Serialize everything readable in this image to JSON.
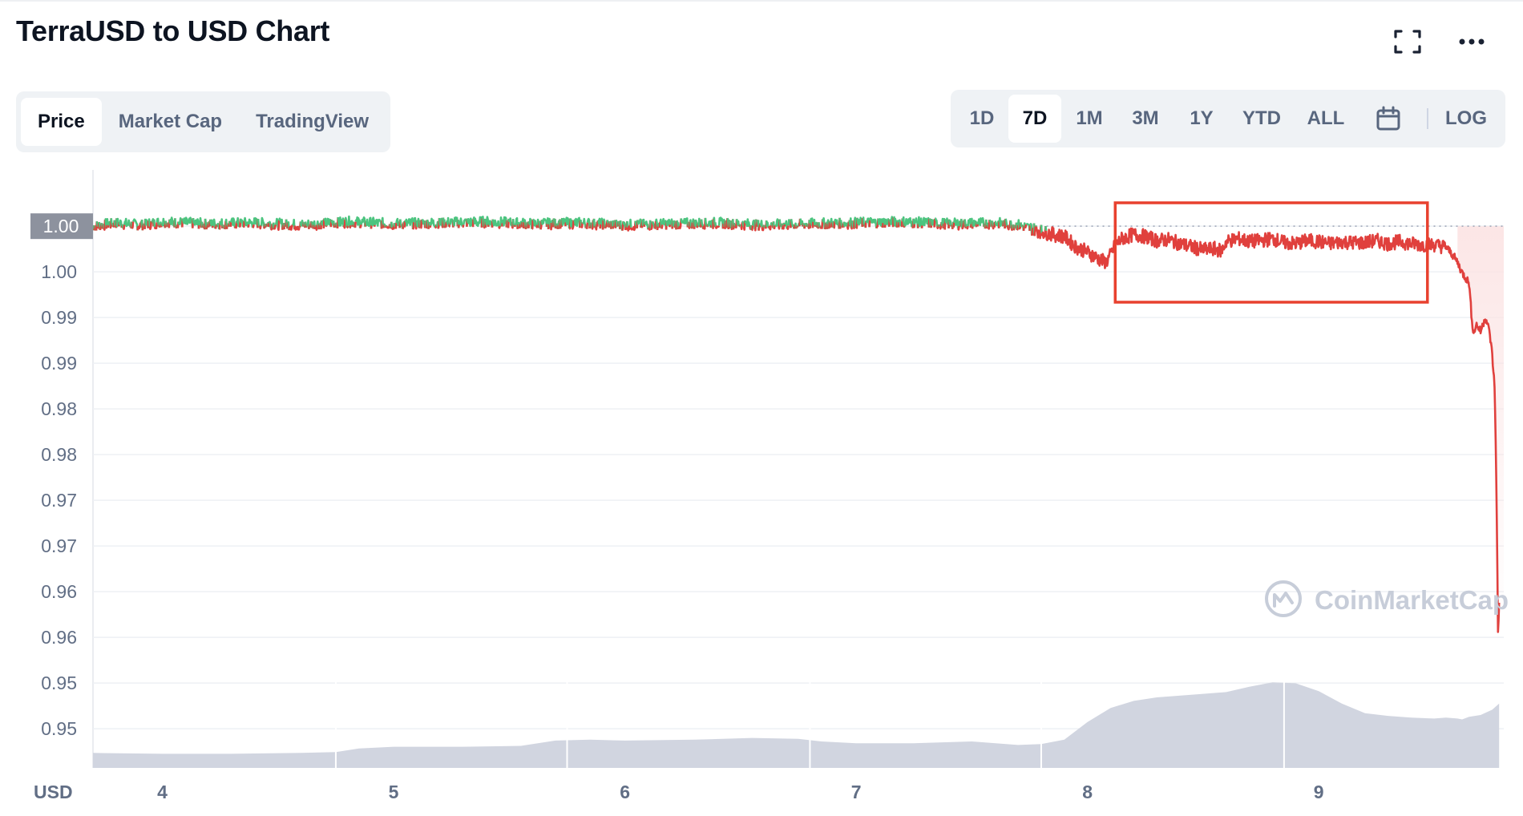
{
  "header": {
    "title": "TerraUSD to USD Chart"
  },
  "icons": {
    "fullscreen": "fullscreen-icon",
    "more": "more-icon",
    "calendar": "calendar-icon"
  },
  "tabs": [
    {
      "label": "Price",
      "active": true
    },
    {
      "label": "Market Cap",
      "active": false
    },
    {
      "label": "TradingView",
      "active": false
    }
  ],
  "ranges": [
    {
      "label": "1D",
      "active": false
    },
    {
      "label": "7D",
      "active": true
    },
    {
      "label": "1M",
      "active": false
    },
    {
      "label": "3M",
      "active": false
    },
    {
      "label": "1Y",
      "active": false
    },
    {
      "label": "YTD",
      "active": false
    },
    {
      "label": "ALL",
      "active": false
    }
  ],
  "log_label": "LOG",
  "watermark": "CoinMarketCap",
  "colors": {
    "up": "#4cc47f",
    "down": "#e0403d",
    "volume": "#d1d5e0",
    "highlight_box": "#e8412f",
    "badge": "#8d929e"
  },
  "chart_data": {
    "type": "line",
    "title": "TerraUSD to USD Chart",
    "ylabel": "USD",
    "y_tick_labels": [
      "1.00",
      "1.00",
      "0.99",
      "0.99",
      "0.98",
      "0.98",
      "0.97",
      "0.97",
      "0.96",
      "0.96",
      "0.95",
      "0.95"
    ],
    "ylim": [
      0.9475,
      1.0025
    ],
    "x_tick_labels": [
      "4",
      "5",
      "6",
      "7",
      "8",
      "9"
    ],
    "xlim": [
      3.7,
      9.8
    ],
    "current_price_label": "1.00",
    "reference_price": 1.0,
    "grid": true,
    "price_series": {
      "name": "Price",
      "x": [
        3.7,
        3.8,
        3.9,
        4.0,
        4.2,
        4.4,
        4.6,
        4.8,
        5.0,
        5.2,
        5.4,
        5.6,
        5.8,
        6.0,
        6.2,
        6.4,
        6.6,
        6.8,
        7.0,
        7.2,
        7.4,
        7.6,
        7.7,
        7.75,
        7.8,
        7.85,
        7.9,
        7.95,
        8.0,
        8.05,
        8.08,
        8.1,
        8.12,
        8.15,
        8.2,
        8.25,
        8.3,
        8.35,
        8.4,
        8.45,
        8.5,
        8.55,
        8.58,
        8.6,
        8.65,
        8.7,
        8.75,
        8.8,
        8.85,
        8.9,
        8.95,
        9.0,
        9.05,
        9.1,
        9.15,
        9.2,
        9.25,
        9.3,
        9.35,
        9.4,
        9.45,
        9.5,
        9.52,
        9.55,
        9.58,
        9.6,
        9.62,
        9.65,
        9.66,
        9.67,
        9.68,
        9.69,
        9.7,
        9.72,
        9.73,
        9.74,
        9.75,
        9.76,
        9.765,
        9.77,
        9.775,
        9.78
      ],
      "y": [
        1.0,
        1.0003,
        1.0001,
        1.0004,
        1.0002,
        1.0003,
        1.0001,
        1.0004,
        1.0002,
        1.0003,
        1.0004,
        1.0002,
        1.0003,
        1.0001,
        1.0002,
        1.0003,
        1.0001,
        1.0002,
        1.0003,
        1.0004,
        1.0002,
        1.0003,
        1.0001,
        0.9998,
        0.9995,
        0.9992,
        0.999,
        0.998,
        0.9975,
        0.9968,
        0.9965,
        0.9972,
        0.9982,
        0.9988,
        0.9992,
        0.999,
        0.9986,
        0.9987,
        0.9983,
        0.998,
        0.9977,
        0.9978,
        0.9976,
        0.9985,
        0.9988,
        0.9985,
        0.9986,
        0.9988,
        0.9984,
        0.9983,
        0.9986,
        0.9985,
        0.9983,
        0.9985,
        0.9984,
        0.9984,
        0.9986,
        0.9983,
        0.9985,
        0.9983,
        0.9982,
        0.9982,
        0.9981,
        0.998,
        0.9972,
        0.9965,
        0.9955,
        0.9945,
        0.9915,
        0.9895,
        0.9905,
        0.9902,
        0.9898,
        0.9912,
        0.9905,
        0.9895,
        0.9875,
        0.9845,
        0.9795,
        0.9715,
        0.9605,
        0.9635
      ]
    },
    "volume_series": {
      "name": "Volume",
      "x": [
        3.7,
        4.0,
        4.3,
        4.6,
        4.75,
        4.85,
        5.0,
        5.3,
        5.55,
        5.7,
        5.85,
        6.0,
        6.3,
        6.55,
        6.75,
        6.85,
        7.0,
        7.25,
        7.5,
        7.7,
        7.8,
        7.9,
        8.0,
        8.1,
        8.2,
        8.3,
        8.5,
        8.6,
        8.7,
        8.8,
        8.9,
        9.0,
        9.1,
        9.2,
        9.3,
        9.4,
        9.5,
        9.55,
        9.6,
        9.62,
        9.65,
        9.7,
        9.75,
        9.78
      ],
      "y": [
        0.17,
        0.16,
        0.16,
        0.17,
        0.18,
        0.22,
        0.24,
        0.24,
        0.25,
        0.31,
        0.32,
        0.31,
        0.32,
        0.34,
        0.33,
        0.3,
        0.28,
        0.28,
        0.3,
        0.26,
        0.27,
        0.32,
        0.52,
        0.68,
        0.76,
        0.8,
        0.84,
        0.86,
        0.92,
        0.97,
        0.96,
        0.87,
        0.73,
        0.62,
        0.59,
        0.57,
        0.56,
        0.57,
        0.56,
        0.55,
        0.58,
        0.6,
        0.66,
        0.73
      ]
    }
  }
}
